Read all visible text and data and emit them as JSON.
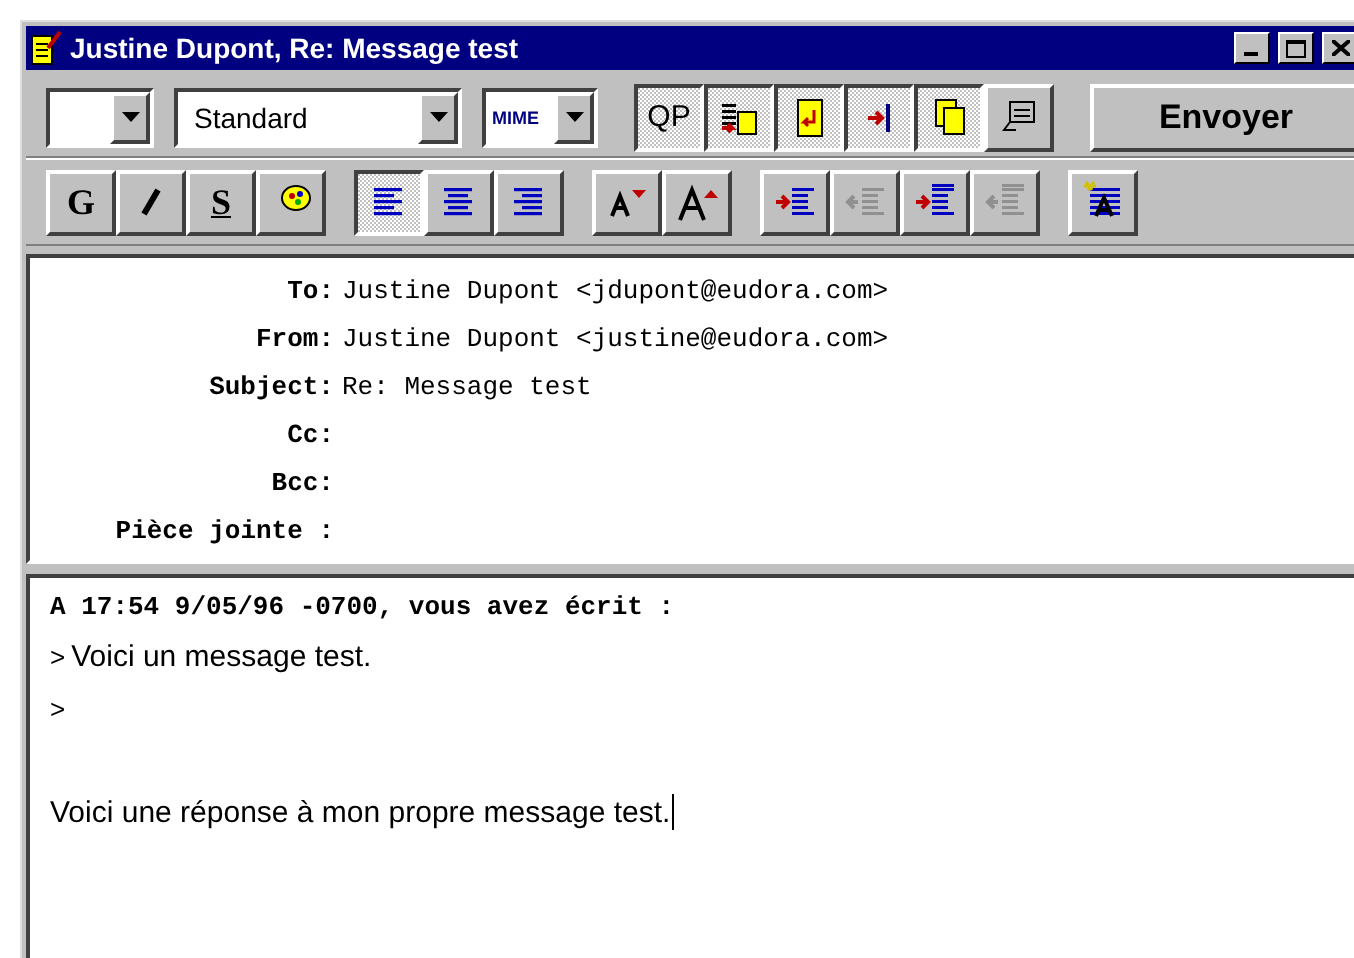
{
  "window": {
    "title": "Justine Dupont, Re: Message test"
  },
  "toolbar": {
    "style_select": {
      "value": "Standard"
    },
    "encoding_select": {
      "value": "MIME"
    },
    "buttons": [
      {
        "kind": "qp",
        "label": "QP",
        "pressed": true
      },
      {
        "kind": "text-attach",
        "pressed": true
      },
      {
        "kind": "word-wrap",
        "pressed": true
      },
      {
        "kind": "tab-insert",
        "pressed": true
      },
      {
        "kind": "keep-copy",
        "pressed": true
      },
      {
        "kind": "receipt",
        "pressed": false
      }
    ],
    "send_button": "Envoyer"
  },
  "format_bar": {
    "groups": [
      {
        "buttons": [
          {
            "kind": "bold",
            "label": "G",
            "pressed": false
          },
          {
            "kind": "italic",
            "pressed": false
          },
          {
            "kind": "underline",
            "label": "S",
            "pressed": false
          },
          {
            "kind": "color",
            "pressed": false
          }
        ]
      },
      {
        "buttons": [
          {
            "kind": "align-left",
            "pressed": true
          },
          {
            "kind": "align-center",
            "pressed": false
          },
          {
            "kind": "align-right",
            "pressed": false
          }
        ]
      },
      {
        "buttons": [
          {
            "kind": "font-smaller",
            "pressed": false
          },
          {
            "kind": "font-larger",
            "pressed": false
          }
        ]
      },
      {
        "buttons": [
          {
            "kind": "indent",
            "pressed": false,
            "disabled": false
          },
          {
            "kind": "outdent",
            "pressed": false,
            "disabled": true
          },
          {
            "kind": "margin-in",
            "pressed": false,
            "disabled": false
          },
          {
            "kind": "margin-out",
            "pressed": false,
            "disabled": true
          }
        ]
      },
      {
        "buttons": [
          {
            "kind": "clear-format",
            "pressed": false
          }
        ]
      }
    ]
  },
  "headers": [
    {
      "label": "To:",
      "value": "Justine Dupont <jdupont@eudora.com>"
    },
    {
      "label": "From:",
      "value": "Justine Dupont <justine@eudora.com>"
    },
    {
      "label": "Subject:",
      "value": "Re: Message test"
    },
    {
      "label": "Cc:"
    },
    {
      "label": "Bcc:"
    },
    {
      "label": "Pièce jointe :"
    }
  ],
  "body": {
    "attribution": "A 17:54 9/05/96 -0700, vous avez écrit :",
    "lines": [
      {
        "kind": "quote",
        "marker": ">",
        "text": "Voici un message test."
      },
      {
        "kind": "quote",
        "marker": ">"
      },
      {
        "kind": "blank"
      },
      {
        "kind": "text",
        "text": "Voici une réponse à mon propre message test."
      }
    ],
    "caret": true
  }
}
